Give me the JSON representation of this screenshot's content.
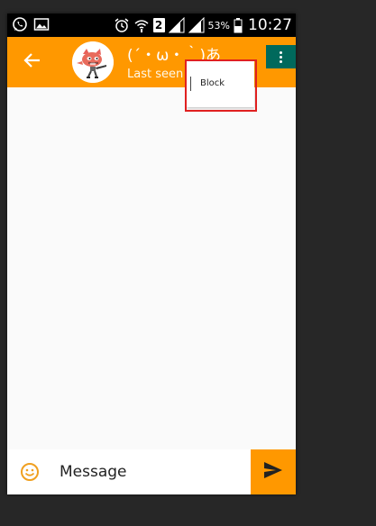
{
  "status_bar": {
    "left_icons": [
      "whatsapp-icon",
      "image-icon"
    ],
    "right_icons": [
      "alarm-icon",
      "wifi-icon",
      "sim-icon",
      "signal-icon",
      "signal-icon",
      "battery-icon"
    ],
    "sim_label": "2",
    "battery_percent": "53%",
    "time": "10:27"
  },
  "toolbar": {
    "back_icon": "arrow-back-icon",
    "contact_name": "(´・ω・｀)あ",
    "last_seen": "Last seen",
    "overflow_icon": "more-vert-icon"
  },
  "popup_menu": {
    "items": [
      {
        "label": "Block"
      }
    ]
  },
  "input_bar": {
    "emoji_icon": "smiley-icon",
    "placeholder": "Message",
    "send_icon": "send-icon"
  },
  "colors": {
    "accent": "#ff9800",
    "overflow_button": "#00695c",
    "highlight": "#e02020",
    "background": "#fafafa"
  }
}
